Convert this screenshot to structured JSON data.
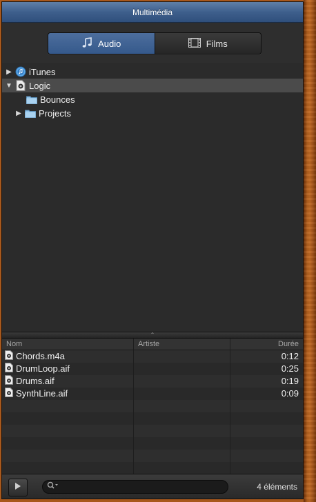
{
  "window": {
    "title": "Multimédia"
  },
  "segments": {
    "audio_label": "Audio",
    "films_label": "Films",
    "selected": "Audio"
  },
  "tree": {
    "items": [
      {
        "label": "iTunes",
        "icon": "itunes-icon",
        "expanded": false
      },
      {
        "label": "Logic",
        "icon": "logic-document-icon",
        "expanded": true,
        "selected": true
      },
      {
        "label": "Bounces",
        "icon": "folder-icon"
      },
      {
        "label": "Projects",
        "icon": "folder-icon",
        "expanded": false
      }
    ]
  },
  "table": {
    "headers": {
      "name": "Nom",
      "artist": "Artiste",
      "duration": "Durée"
    },
    "rows": [
      {
        "name": "Chords.m4a",
        "artist": "",
        "duration": "0:12"
      },
      {
        "name": "DrumLoop.aif",
        "artist": "",
        "duration": "0:25"
      },
      {
        "name": "Drums.aif",
        "artist": "",
        "duration": "0:19"
      },
      {
        "name": "SynthLine.aif",
        "artist": "",
        "duration": "0:09"
      }
    ]
  },
  "footer": {
    "search_value": "",
    "item_count": "4 éléments"
  },
  "colors": {
    "accent": "#3e5f8c",
    "panel": "#2b2b2b",
    "wood": "#a8581c"
  }
}
